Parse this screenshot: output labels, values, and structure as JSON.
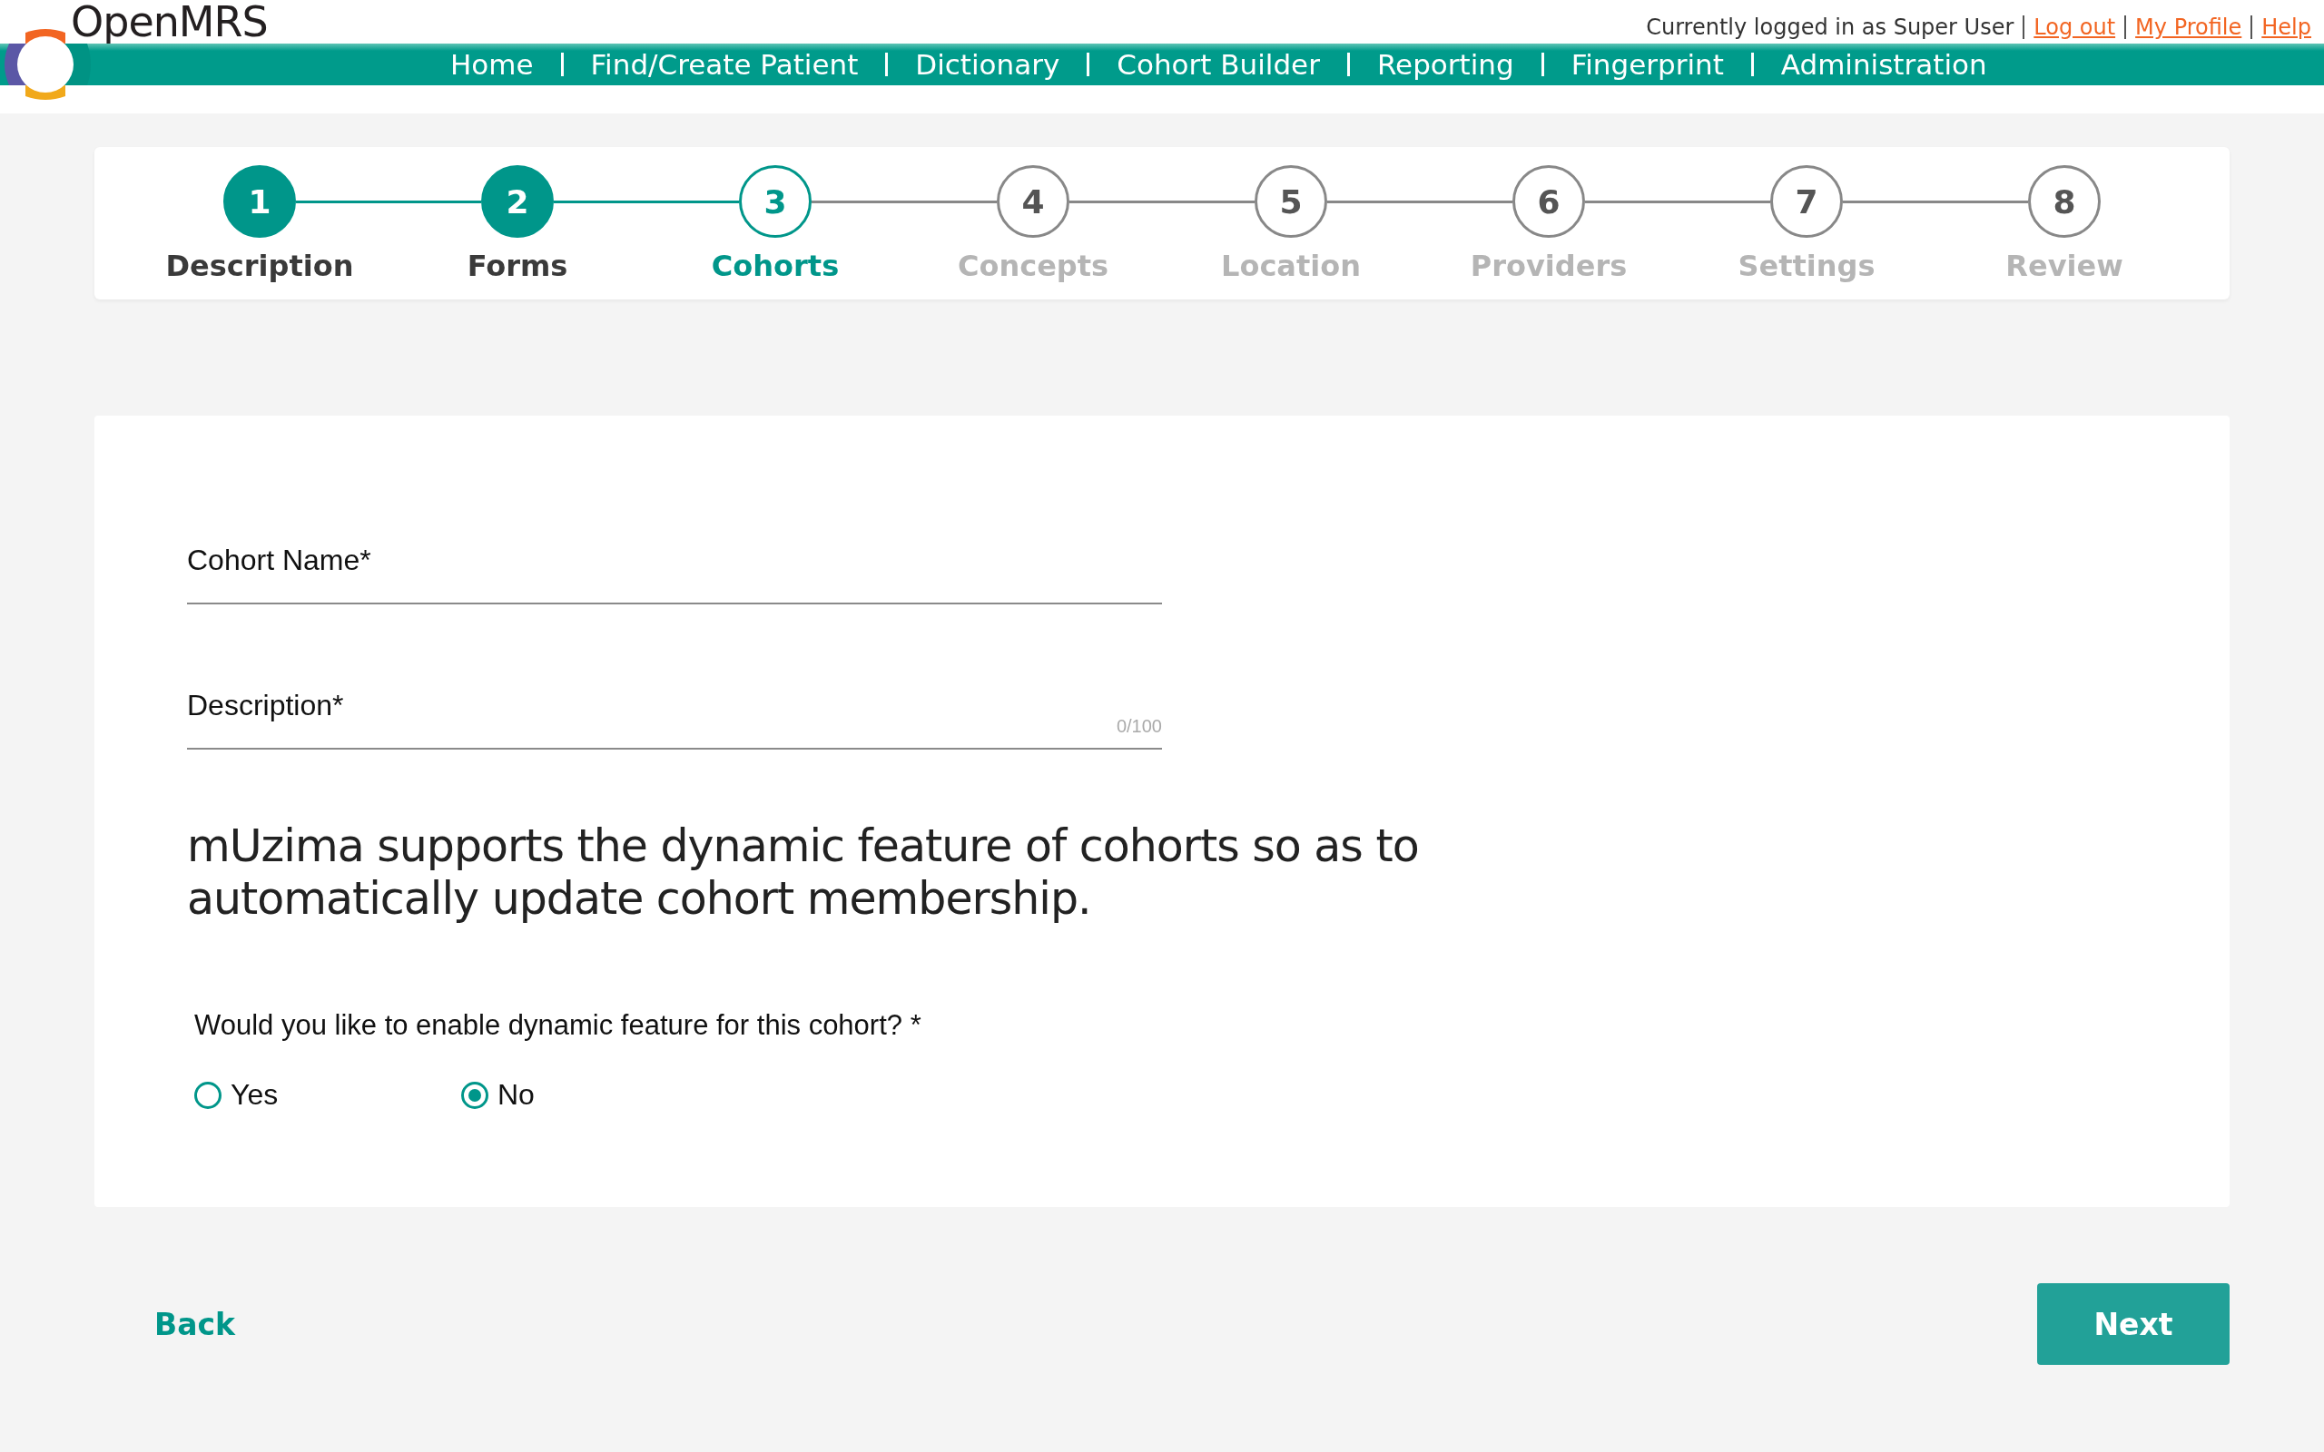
{
  "header": {
    "brand": "OpenMRS",
    "user_info": "Currently logged in as Super User",
    "user_links": [
      {
        "label": "Log out"
      },
      {
        "label": "My Profile"
      },
      {
        "label": "Help"
      }
    ],
    "nav": [
      {
        "label": "Home"
      },
      {
        "label": "Find/Create Patient"
      },
      {
        "label": "Dictionary"
      },
      {
        "label": "Cohort Builder"
      },
      {
        "label": "Reporting"
      },
      {
        "label": "Fingerprint"
      },
      {
        "label": "Administration"
      }
    ]
  },
  "steps": [
    {
      "number": "1",
      "label": "Description",
      "completed": true,
      "selected": false
    },
    {
      "number": "2",
      "label": "Forms",
      "completed": true,
      "selected": false
    },
    {
      "number": "3",
      "label": "Cohorts",
      "completed": false,
      "selected": true
    },
    {
      "number": "4",
      "label": "Concepts",
      "completed": false,
      "selected": false
    },
    {
      "number": "5",
      "label": "Location",
      "completed": false,
      "selected": false
    },
    {
      "number": "6",
      "label": "Providers",
      "completed": false,
      "selected": false
    },
    {
      "number": "7",
      "label": "Settings",
      "completed": false,
      "selected": false
    },
    {
      "number": "8",
      "label": "Review",
      "completed": false,
      "selected": false
    }
  ],
  "form": {
    "fields": [
      {
        "label": "Cohort Name*"
      },
      {
        "label": "Description*",
        "counter": "0/100"
      }
    ],
    "info": "mUzima supports the dynamic feature of cohorts so as to automatically update cohort membership.",
    "question": "Would you like to enable dynamic feature for this cohort? *",
    "options": [
      {
        "label": "Yes",
        "selected": false
      },
      {
        "label": "No",
        "selected": true
      }
    ]
  },
  "actions": {
    "back": "Back",
    "next": "Next"
  }
}
